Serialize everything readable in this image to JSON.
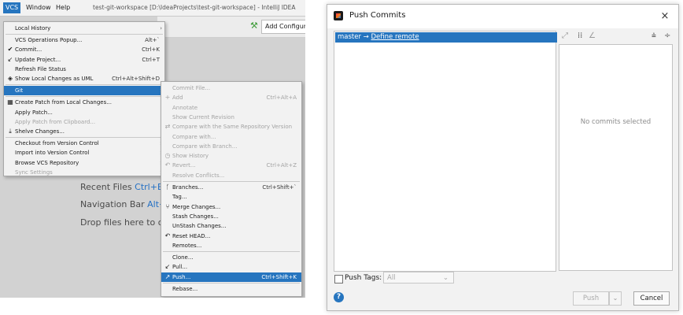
{
  "ide": {
    "menubar": {
      "vcs": "VCS",
      "window": "Window",
      "help": "Help"
    },
    "title": "test-git-workspace [D:\\IdeaProjects\\test-git-workspace] - IntelliJ IDEA",
    "toolbar": {
      "add_configuration": "Add Configura"
    },
    "hints": [
      {
        "text": "Recent Files ",
        "key": "Ctrl+E"
      },
      {
        "text": "Navigation Bar ",
        "key": "Alt+Ho"
      },
      {
        "text": "Drop files here to oper",
        "key": ""
      }
    ],
    "vcs_menu": [
      {
        "label": "Local History",
        "shortcut": "",
        "submenu": true,
        "icon": ""
      },
      {
        "label": "VCS Operations Popup...",
        "shortcut": "Alt+`",
        "icon": ""
      },
      {
        "label": "Commit...",
        "shortcut": "Ctrl+K",
        "icon": "✔"
      },
      {
        "label": "Update Project...",
        "shortcut": "Ctrl+T",
        "icon": "↙"
      },
      {
        "label": "Refresh File Status",
        "shortcut": "",
        "icon": ""
      },
      {
        "label": "Show Local Changes as UML",
        "shortcut": "Ctrl+Alt+Shift+D",
        "icon": "◈"
      },
      {
        "label": "Git",
        "shortcut": "",
        "submenu": true,
        "selected": true,
        "icon": ""
      },
      {
        "label": "Create Patch from Local Changes...",
        "shortcut": "",
        "icon": "▦"
      },
      {
        "label": "Apply Patch...",
        "shortcut": "",
        "icon": ""
      },
      {
        "label": "Apply Patch from Clipboard...",
        "shortcut": "",
        "disabled": true,
        "icon": ""
      },
      {
        "label": "Shelve Changes...",
        "shortcut": "",
        "icon": "⤓"
      },
      {
        "label": "Checkout from Version Control",
        "shortcut": "",
        "submenu": true,
        "icon": ""
      },
      {
        "label": "Import into Version Control",
        "shortcut": "",
        "submenu": true,
        "icon": ""
      },
      {
        "label": "Browse VCS Repository",
        "shortcut": "",
        "submenu": true,
        "icon": ""
      },
      {
        "label": "Sync Settings",
        "shortcut": "",
        "submenu": true,
        "disabled": true,
        "icon": ""
      }
    ],
    "git_menu": [
      {
        "label": "Commit File...",
        "shortcut": "",
        "disabled": true,
        "icon": ""
      },
      {
        "label": "Add",
        "shortcut": "Ctrl+Alt+A",
        "disabled": true,
        "icon": "+"
      },
      {
        "label": "Annotate",
        "shortcut": "",
        "disabled": true,
        "icon": ""
      },
      {
        "label": "Show Current Revision",
        "shortcut": "",
        "disabled": true,
        "icon": ""
      },
      {
        "label": "Compare with the Same Repository Version",
        "shortcut": "",
        "disabled": true,
        "icon": "⇄"
      },
      {
        "label": "Compare with...",
        "shortcut": "",
        "disabled": true,
        "icon": ""
      },
      {
        "label": "Compare with Branch...",
        "shortcut": "",
        "disabled": true,
        "icon": ""
      },
      {
        "label": "Show History",
        "shortcut": "",
        "disabled": true,
        "icon": "◷"
      },
      {
        "label": "Revert...",
        "shortcut": "Ctrl+Alt+Z",
        "disabled": true,
        "icon": "↶"
      },
      {
        "label": "Resolve Conflicts...",
        "shortcut": "",
        "disabled": true,
        "icon": ""
      },
      {
        "label": "Branches...",
        "shortcut": "Ctrl+Shift+`",
        "icon": "ᚴ"
      },
      {
        "label": "Tag...",
        "shortcut": "",
        "icon": ""
      },
      {
        "label": "Merge Changes...",
        "shortcut": "",
        "icon": "⑂"
      },
      {
        "label": "Stash Changes...",
        "shortcut": "",
        "icon": ""
      },
      {
        "label": "UnStash Changes...",
        "shortcut": "",
        "icon": ""
      },
      {
        "label": "Reset HEAD...",
        "shortcut": "",
        "icon": "↶"
      },
      {
        "label": "Remotes...",
        "shortcut": "",
        "icon": ""
      },
      {
        "label": "Clone...",
        "shortcut": "",
        "icon": ""
      },
      {
        "label": "Pull...",
        "shortcut": "",
        "icon": "↙"
      },
      {
        "label": "Push...",
        "shortcut": "Ctrl+Shift+K",
        "selected": true,
        "icon": "↗"
      },
      {
        "label": "Rebase...",
        "shortcut": "",
        "icon": ""
      }
    ]
  },
  "dialog": {
    "title": "Push Commits",
    "close": "×",
    "commit_row": {
      "branch": "master",
      "arrow": " → ",
      "remote": "Define remote"
    },
    "detail": {
      "empty_text": "No commits selected"
    },
    "push_tags": {
      "label": "Push Tags:",
      "value": "All"
    },
    "help": "?",
    "buttons": {
      "push": "Push",
      "dropdown": "⌄",
      "cancel": "Cancel"
    }
  },
  "colors": {
    "accent": "#2675bf",
    "menu_bg": "#f2f2f2",
    "ide_bg": "#d2d2d2"
  }
}
